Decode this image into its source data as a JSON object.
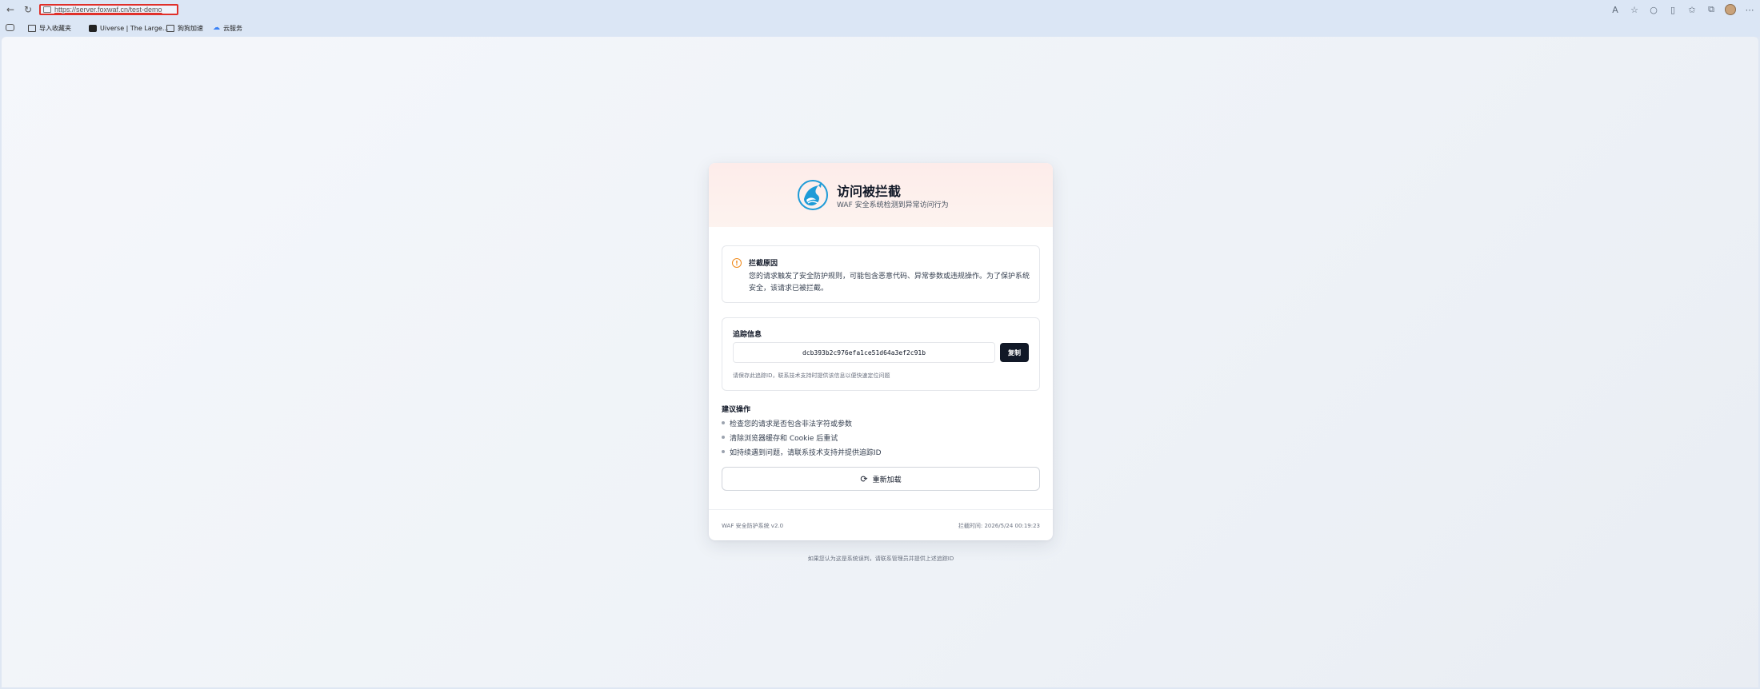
{
  "browser": {
    "url": "https://server.foxwaf.cn/test-demo",
    "bookmarks": [
      {
        "label": "导入收藏夹",
        "icon": "folder-import-icon"
      },
      {
        "label": "Uiverse | The Large...",
        "icon": "uiverse-icon"
      },
      {
        "label": "狗狗加速",
        "icon": "folder-icon"
      },
      {
        "label": "云服务",
        "icon": "cloud-icon"
      }
    ]
  },
  "card": {
    "title": "访问被拦截",
    "subtitle": "WAF 安全系统检测到异常访问行为",
    "reason": {
      "title": "拦截原因",
      "text": "您的请求触发了安全防护规则，可能包含恶意代码、异常参数或违规操作。为了保护系统安全，该请求已被拦截。"
    },
    "trace": {
      "title": "追踪信息",
      "id": "dcb393b2c976efa1ce51d64a3ef2c91b",
      "copy_label": "复制",
      "hint": "请保存此追踪ID，联系技术支持时提供该信息以便快速定位问题"
    },
    "suggestions": {
      "title": "建议操作",
      "items": [
        "检查您的请求是否包含非法字符或参数",
        "清除浏览器缓存和 Cookie 后重试",
        "如持续遇到问题，请联系技术支持并提供追踪ID"
      ]
    },
    "reload_label": "重新加载",
    "footer": {
      "left": "WAF 安全防护系统 v2.0",
      "right": "拦截时间: 2026/5/24 00:19:23"
    }
  },
  "page_note": "如果您认为这是系统误判，请联系管理员并提供上述追踪ID"
}
